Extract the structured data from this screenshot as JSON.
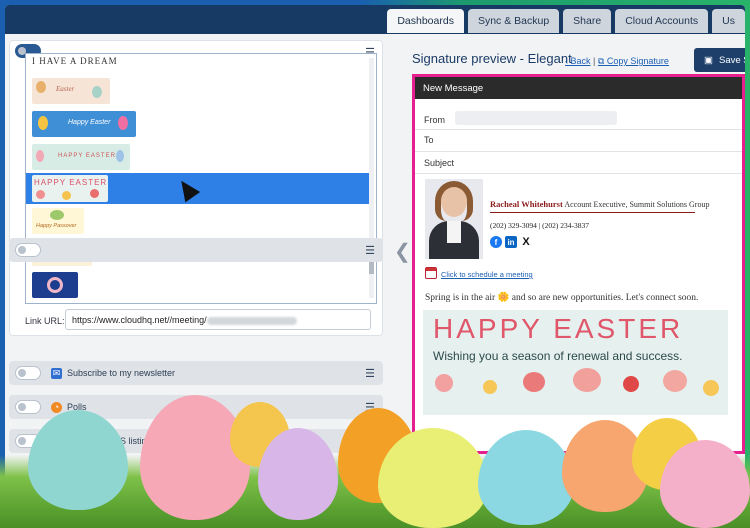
{
  "tabs": [
    "Dashboards",
    "Sync & Backup",
    "Share",
    "Cloud Accounts",
    "Us"
  ],
  "active_tab": "Dashboards",
  "left_panel": {
    "dropdown_header_text": "I HAVE A DREAM",
    "link_url_label": "Link URL:",
    "link_url_value": "https://www.cloudhq.net//meeting/",
    "rows": [
      {
        "label": "Subscribe to my newsletter",
        "icon": "envelope-icon"
      },
      {
        "label": "Polls",
        "icon": "poll-icon"
      },
      {
        "label": "ur MLS listings",
        "icon": "listing-icon"
      }
    ],
    "dropdown_options": [
      {
        "name": "banner-easter-cream",
        "text": "Easter"
      },
      {
        "name": "banner-happy-easter-blue",
        "text": "Happy Easter"
      },
      {
        "name": "banner-happy-easter-teal",
        "text": "HAPPY EASTER"
      },
      {
        "name": "banner-happy-easter-pink",
        "text": "HAPPY EASTER"
      },
      {
        "name": "banner-happy-passover",
        "text": "Happy Passover"
      },
      {
        "name": "banner-blue-sofa",
        "text": ""
      },
      {
        "name": "banner-navy-wreath",
        "text": ""
      }
    ]
  },
  "right_panel": {
    "title": "Signature preview - Elegant",
    "back_link": "Back",
    "copy_link": "Copy Signature",
    "save_button": "Save S",
    "message": {
      "window_title": "New Message",
      "from_label": "From",
      "to_label": "To",
      "subject_label": "Subject"
    },
    "signature": {
      "name": "Racheal Whitehurst",
      "role": "Account Executive, Summit Solutions Group",
      "phones": "(202) 329-3094 | (202) 234-3837",
      "schedule_link": "Click to schedule a meeting",
      "social": [
        "facebook-icon",
        "linkedin-icon",
        "x-icon"
      ]
    },
    "body_text": "Spring is in the air 🌼 and so are new opportunities. Let's connect soon.",
    "banner": {
      "title": "HAPPY EASTER",
      "subtitle": "Wishing you a season of renewal and success."
    }
  },
  "colors": {
    "topbar": "#163a63",
    "accent_border": "#e61f8f",
    "selection": "#2e7fe6"
  }
}
